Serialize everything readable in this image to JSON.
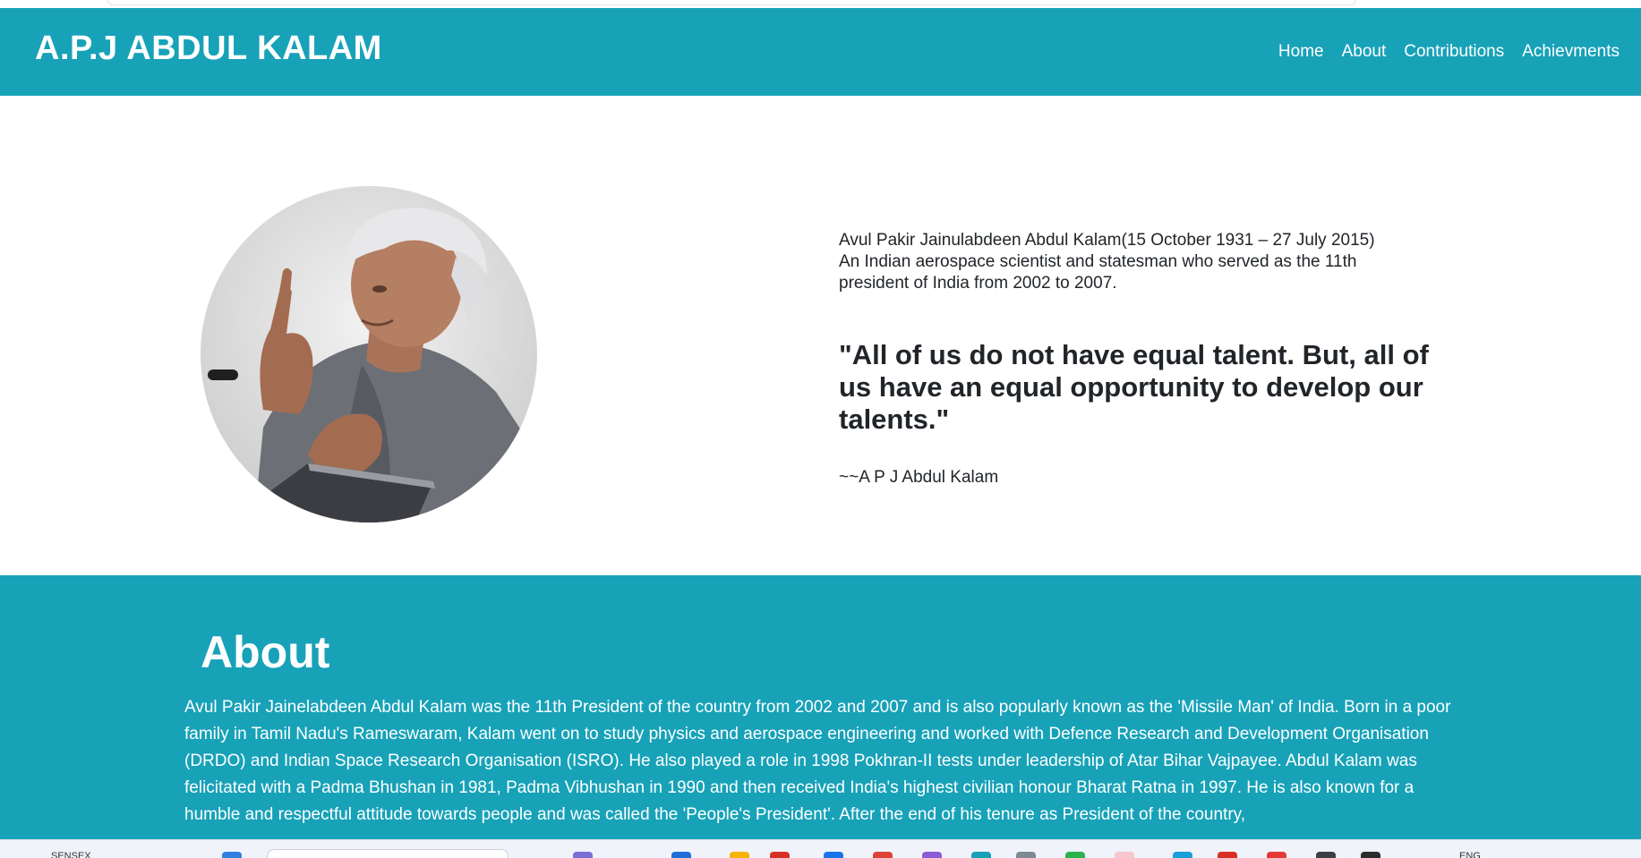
{
  "navbar": {
    "brand": "A.P.J ABDUL KALAM",
    "links": [
      "Home",
      "About",
      "Contributions",
      "Achievments"
    ]
  },
  "hero": {
    "bio_line1": "Avul Pakir Jainulabdeen Abdul Kalam(15 October 1931 – 27 July 2015)",
    "bio_line2": "An Indian aerospace scientist and statesman who served as the 11th president of India from 2002 to 2007.",
    "quote": "\"All of us do not have equal talent. But, all of us have an equal opportunity to develop our talents.\"",
    "quote_author": "~~A P J Abdul Kalam"
  },
  "about": {
    "title": "About",
    "body": "Avul Pakir Jainelabdeen Abdul Kalam was the 11th President of the country from 2002 and 2007 and is also popularly known as the 'Missile Man' of India. Born in a poor family in Tamil Nadu's Rameswaram, Kalam went on to study physics and aerospace engineering and worked with Defence Research and Development Organisation (DRDO) and Indian Space Research Organisation (ISRO). He also played a role in 1998 Pokhran-II tests under leadership of Atar Bihar Vajpayee. Abdul Kalam was felicitated with a Padma Bhushan in 1981, Padma Vibhushan in 1990 and then received India's highest civilian honour Bharat Ratna in 1997. He is also known for a humble and respectful attitude towards people and was called the 'People's President'. After the end of his tenure as President of the country,"
  },
  "taskbar": {
    "left_label": "SENSEX",
    "lang": "ENG"
  },
  "colors": {
    "accent": "#17a2b8",
    "text": "#212529"
  }
}
